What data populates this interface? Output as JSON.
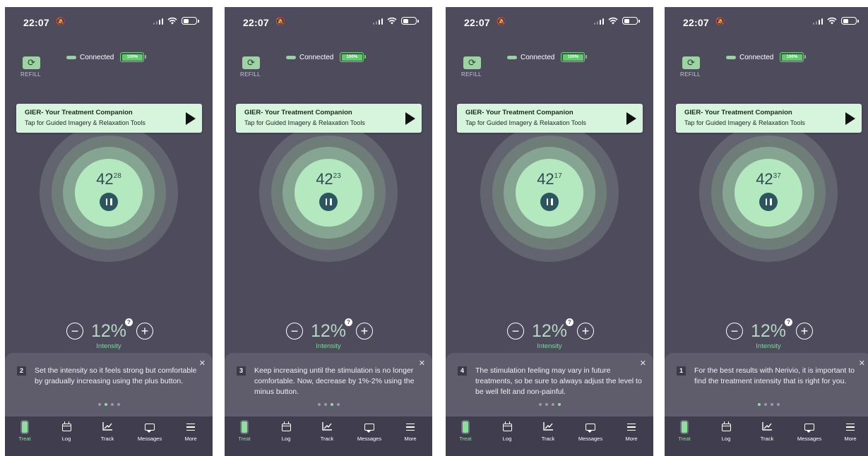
{
  "colors": {
    "background": "#4d4b5c",
    "accent": "#8be09e",
    "banner": "#d7f5dc",
    "tab_bar": "#403e4e"
  },
  "screens": [
    {
      "status": {
        "time": "22:07",
        "bell": "🔕"
      },
      "connection": {
        "refill_label": "REFILL",
        "label": "Connected",
        "battery": "100%"
      },
      "banner": {
        "title": "GIER- Your Treatment Companion",
        "subtitle": "Tap for Guided Imagery & Relaxation Tools"
      },
      "timer": {
        "minutes": "42",
        "seconds": "28"
      },
      "intensity": {
        "value": "12%",
        "label": "Intensity",
        "help": "?"
      },
      "coach": {
        "step": "2",
        "text": "Set the intensity so it feels strong but comfortable by gradually increasing using the plus button.",
        "active_dot": 1,
        "dot_count": 4
      },
      "tabs": [
        {
          "label": "Treat",
          "icon": "treat-pill-icon",
          "active": true
        },
        {
          "label": "Log",
          "icon": "calendar-icon",
          "active": false
        },
        {
          "label": "Track",
          "icon": "chart-icon",
          "active": false
        },
        {
          "label": "Messages",
          "icon": "chat-icon",
          "active": false
        },
        {
          "label": "More",
          "icon": "menu-icon",
          "active": false
        }
      ]
    },
    {
      "status": {
        "time": "22:07",
        "bell": "🔕"
      },
      "connection": {
        "refill_label": "REFILL",
        "label": "Connected",
        "battery": "100%"
      },
      "banner": {
        "title": "GIER- Your Treatment Companion",
        "subtitle": "Tap for Guided Imagery & Relaxation Tools"
      },
      "timer": {
        "minutes": "42",
        "seconds": "23"
      },
      "intensity": {
        "value": "12%",
        "label": "Intensity",
        "help": "?"
      },
      "coach": {
        "step": "3",
        "text": "Keep increasing until the stimulation is no longer comfortable. Now, decrease by 1%-2% using the minus button.",
        "active_dot": 2,
        "dot_count": 4
      },
      "tabs": [
        {
          "label": "Treat",
          "icon": "treat-pill-icon",
          "active": true
        },
        {
          "label": "Log",
          "icon": "calendar-icon",
          "active": false
        },
        {
          "label": "Track",
          "icon": "chart-icon",
          "active": false
        },
        {
          "label": "Messages",
          "icon": "chat-icon",
          "active": false
        },
        {
          "label": "More",
          "icon": "menu-icon",
          "active": false
        }
      ]
    },
    {
      "status": {
        "time": "22:07",
        "bell": "🔕"
      },
      "connection": {
        "refill_label": "REFILL",
        "label": "Connected",
        "battery": "100%"
      },
      "banner": {
        "title": "GIER- Your Treatment Companion",
        "subtitle": "Tap for Guided Imagery & Relaxation Tools"
      },
      "timer": {
        "minutes": "42",
        "seconds": "17"
      },
      "intensity": {
        "value": "12%",
        "label": "Intensity",
        "help": "?"
      },
      "coach": {
        "step": "4",
        "text": "The stimulation feeling may vary in future treatments, so be sure to always adjust the level to be well felt and non-painful.",
        "active_dot": 3,
        "dot_count": 4
      },
      "tabs": [
        {
          "label": "Treat",
          "icon": "treat-pill-icon",
          "active": true
        },
        {
          "label": "Log",
          "icon": "calendar-icon",
          "active": false
        },
        {
          "label": "Track",
          "icon": "chart-icon",
          "active": false
        },
        {
          "label": "Messages",
          "icon": "chat-icon",
          "active": false
        },
        {
          "label": "More",
          "icon": "menu-icon",
          "active": false
        }
      ]
    },
    {
      "status": {
        "time": "22:07",
        "bell": "🔕"
      },
      "connection": {
        "refill_label": "REFILL",
        "label": "Connected",
        "battery": "100%"
      },
      "banner": {
        "title": "GIER- Your Treatment Companion",
        "subtitle": "Tap for Guided Imagery & Relaxation Tools"
      },
      "timer": {
        "minutes": "42",
        "seconds": "37"
      },
      "intensity": {
        "value": "12%",
        "label": "Intensity",
        "help": "?"
      },
      "coach": {
        "step": "1",
        "text": "For the best results with Nerivio, it is important to find the treatment intensity that is right for you.",
        "active_dot": 0,
        "dot_count": 4
      },
      "tabs": [
        {
          "label": "Treat",
          "icon": "treat-pill-icon",
          "active": true
        },
        {
          "label": "Log",
          "icon": "calendar-icon",
          "active": false
        },
        {
          "label": "Track",
          "icon": "chart-icon",
          "active": false
        },
        {
          "label": "Messages",
          "icon": "chat-icon",
          "active": false
        },
        {
          "label": "More",
          "icon": "menu-icon",
          "active": false
        }
      ]
    }
  ]
}
